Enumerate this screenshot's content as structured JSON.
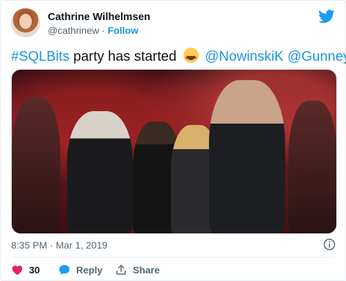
{
  "author": {
    "name": "Cathrine Wilhelmsen",
    "handle": "@cathrinew",
    "separator": " · ",
    "follow_label": "Follow"
  },
  "tweet": {
    "hashtag": "#SQLBits",
    "text": " party has started ",
    "mentions": [
      "@NowinskiK",
      "@GunneyK"
    ],
    "emoji": "star-struck-emoji"
  },
  "media": {
    "description": "photo"
  },
  "meta": {
    "timestamp": "8:35 PM · Mar 1, 2019"
  },
  "actions": {
    "like_count": "30",
    "reply_label": "Reply",
    "share_label": "Share"
  },
  "colors": {
    "accent": "#1b95e0",
    "like": "#e0245e",
    "muted": "#536471",
    "text": "#0f1419"
  }
}
